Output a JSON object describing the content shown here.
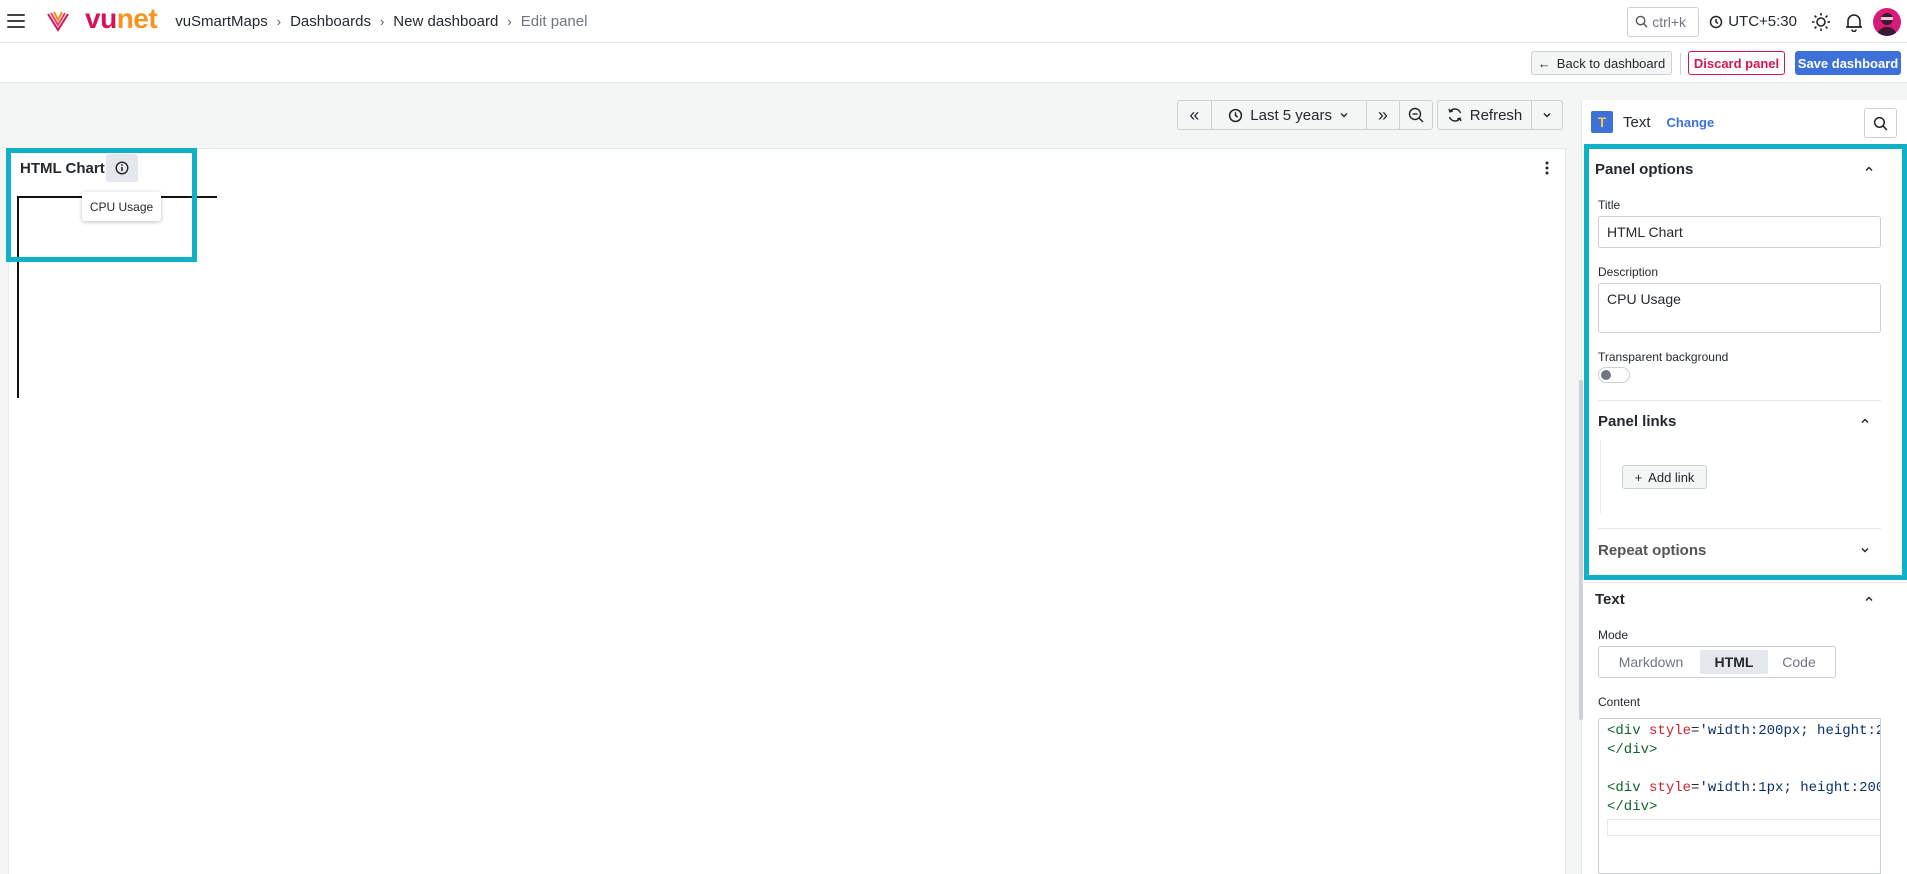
{
  "app": {
    "brand": "vunet",
    "brand_vu": "vu",
    "brand_net": "net"
  },
  "breadcrumb": [
    {
      "label": "vuSmartMaps"
    },
    {
      "label": "Dashboards"
    },
    {
      "label": "New dashboard"
    },
    {
      "label": "Edit panel"
    }
  ],
  "topbar": {
    "search_shortcut": "ctrl+k",
    "timezone": "UTC+5:30"
  },
  "actions": {
    "back": "Back to dashboard",
    "discard": "Discard panel",
    "save": "Save dashboard"
  },
  "time": {
    "range": "Last 5 years",
    "refresh": "Refresh"
  },
  "panel": {
    "title": "HTML Chart",
    "tooltip": "CPU Usage"
  },
  "sidebar": {
    "viz_name": "Text",
    "viz_icon_letter": "T",
    "change": "Change",
    "panel_options": {
      "heading": "Panel options",
      "title_label": "Title",
      "title_value": "HTML Chart",
      "description_label": "Description",
      "description_value": "CPU Usage",
      "transparent_label": "Transparent background"
    },
    "panel_links": {
      "heading": "Panel links",
      "add_link": "Add link"
    },
    "repeat_options": {
      "heading": "Repeat options"
    },
    "text_section": {
      "heading": "Text",
      "mode_label": "Mode",
      "modes": [
        "Markdown",
        "HTML",
        "Code"
      ],
      "active_mode": "HTML",
      "content_label": "Content",
      "code": {
        "l1_open": "<div ",
        "l1_attr": "style",
        "l1_eq": "=",
        "l1_str": "'width:200px; height:2",
        "l2": "</div>",
        "l4_open": "<div ",
        "l4_attr": "style",
        "l4_eq": "=",
        "l4_str": "'width:1px; height:200",
        "l5": "</div>"
      }
    }
  },
  "colors": {
    "accent": "#0fb0c8",
    "primary": "#3d71d9",
    "danger": "#d4145a",
    "brand_net": "#f7931e"
  }
}
